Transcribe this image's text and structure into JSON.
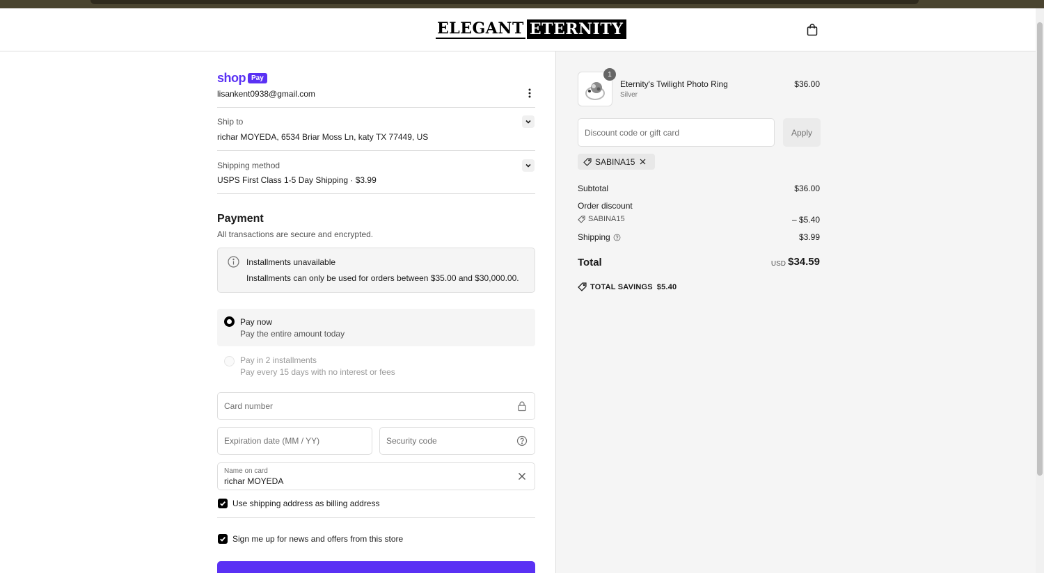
{
  "header": {
    "logo_left": "ELEGANT",
    "logo_right": "ETERNITY",
    "cart_icon": "shopping-bag-icon"
  },
  "account": {
    "shop_label": "shop",
    "pay_badge": "Pay",
    "email": "lisankent0938@gmail.com"
  },
  "ship_to": {
    "label": "Ship to",
    "value": "richar MOYEDA, 6534 Briar Moss Ln, katy TX 77449, US"
  },
  "shipping_method": {
    "label": "Shipping method",
    "value": "USPS First Class 1-5 Day Shipping · $3.99"
  },
  "payment": {
    "title": "Payment",
    "subtitle": "All transactions are secure and encrypted.",
    "notice_title": "Installments unavailable",
    "notice_text": "Installments can only be used for orders between $35.00 and $30,000.00.",
    "option_now_title": "Pay now",
    "option_now_desc": "Pay the entire amount today",
    "option_inst_title": "Pay in 2 installments",
    "option_inst_desc": "Pay every 15 days with no interest or fees",
    "card_number_placeholder": "Card number",
    "expiry_placeholder": "Expiration date (MM / YY)",
    "security_placeholder": "Security code",
    "name_label": "Name on card",
    "name_value": "richar MOYEDA",
    "billing_checkbox": "Use shipping address as billing address",
    "newsletter_checkbox": "Sign me up for news and offers from this store",
    "accent": "#5a31f4"
  },
  "summary": {
    "quantity": "1",
    "product_name": "Eternity's Twilight Photo Ring",
    "product_variant": "Silver",
    "product_price": "$36.00",
    "discount_placeholder": "Discount code or gift card",
    "apply_label": "Apply",
    "applied_code": "SABINA15",
    "subtotal_label": "Subtotal",
    "subtotal_value": "$36.00",
    "order_discount_label": "Order discount",
    "discount_code": "SABINA15",
    "discount_value": "– $5.40",
    "shipping_label": "Shipping",
    "shipping_value": "$3.99",
    "total_label": "Total",
    "currency": "USD",
    "total_value": "$34.59",
    "savings_label": "TOTAL SAVINGS",
    "savings_value": "$5.40"
  }
}
